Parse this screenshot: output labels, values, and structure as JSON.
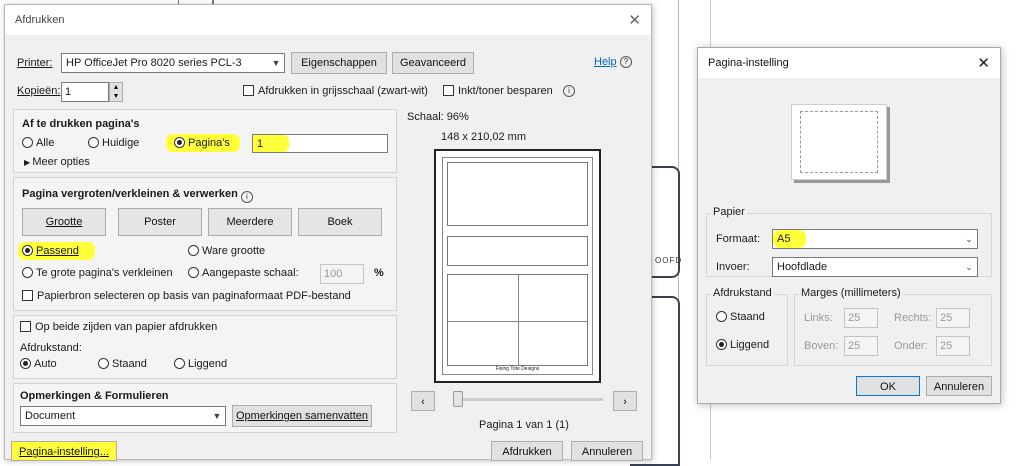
{
  "print_dialog": {
    "title": "Afdrukken",
    "printer_label": "Printer:",
    "printer_value": "HP OfficeJet Pro 8020 series PCL-3",
    "properties_button": "Eigenschappen",
    "advanced_button": "Geavanceerd",
    "help_link": "Help",
    "copies_label": "Kopieën:",
    "copies_value": "1",
    "grayscale_label": "Afdrukken in grijsschaal (zwart-wit)",
    "save_ink_label": "Inkt/toner besparen",
    "pages_section": {
      "title": "Af te drukken pagina's",
      "all": "Alle",
      "current": "Huidige",
      "pages": "Pagina's",
      "pages_value": "1",
      "more_options": "Meer opties"
    },
    "scaling_section": {
      "title": "Pagina vergroten/verkleinen & verwerken",
      "tabs": [
        "Grootte",
        "Poster",
        "Meerdere",
        "Boek"
      ],
      "fit": "Passend",
      "actual_size": "Ware grootte",
      "shrink": "Te grote pagina's verkleinen",
      "custom_scale": "Aangepaste schaal:",
      "custom_scale_value": "100",
      "percent": "%",
      "paper_source": "Papierbron selecteren op basis van paginaformaat PDF-bestand"
    },
    "duplex_section": {
      "both_sides": "Op beide zijden van papier afdrukken",
      "orientation_label": "Afdrukstand:",
      "auto": "Auto",
      "portrait": "Staand",
      "landscape": "Liggend"
    },
    "comments_section": {
      "title": "Opmerkingen & Formulieren",
      "select_value": "Document",
      "summarize_button": "Opmerkingen samenvatten"
    },
    "preview": {
      "scale": "Schaal: 96%",
      "size": "148 x 210,02 mm",
      "page_info": "Pagina 1 van 1 (1)",
      "footer_text": "Fixing Tote Designs"
    },
    "page_setup_button": "Pagina-instelling...",
    "print_button": "Afdrukken",
    "cancel_button": "Annuleren"
  },
  "setup_dialog": {
    "title": "Pagina-instelling",
    "paper_group": "Papier",
    "format_label": "Formaat:",
    "format_value": "A5",
    "source_label": "Invoer:",
    "source_value": "Hoofdlade",
    "orientation_group": "Afdrukstand",
    "portrait": "Staand",
    "landscape": "Liggend",
    "margins_group": "Marges (millimeters)",
    "left_label": "Links:",
    "left_value": "25",
    "right_label": "Rechts:",
    "right_value": "25",
    "top_label": "Boven:",
    "top_value": "25",
    "bottom_label": "Onder:",
    "bottom_value": "25",
    "ok_button": "OK",
    "cancel_button": "Annuleren"
  },
  "background": {
    "fragment_text": "OOFD"
  },
  "colors": {
    "highlight": "#ffff3a",
    "dialog_bg": "#f0f0f0",
    "link": "#0066cc"
  }
}
